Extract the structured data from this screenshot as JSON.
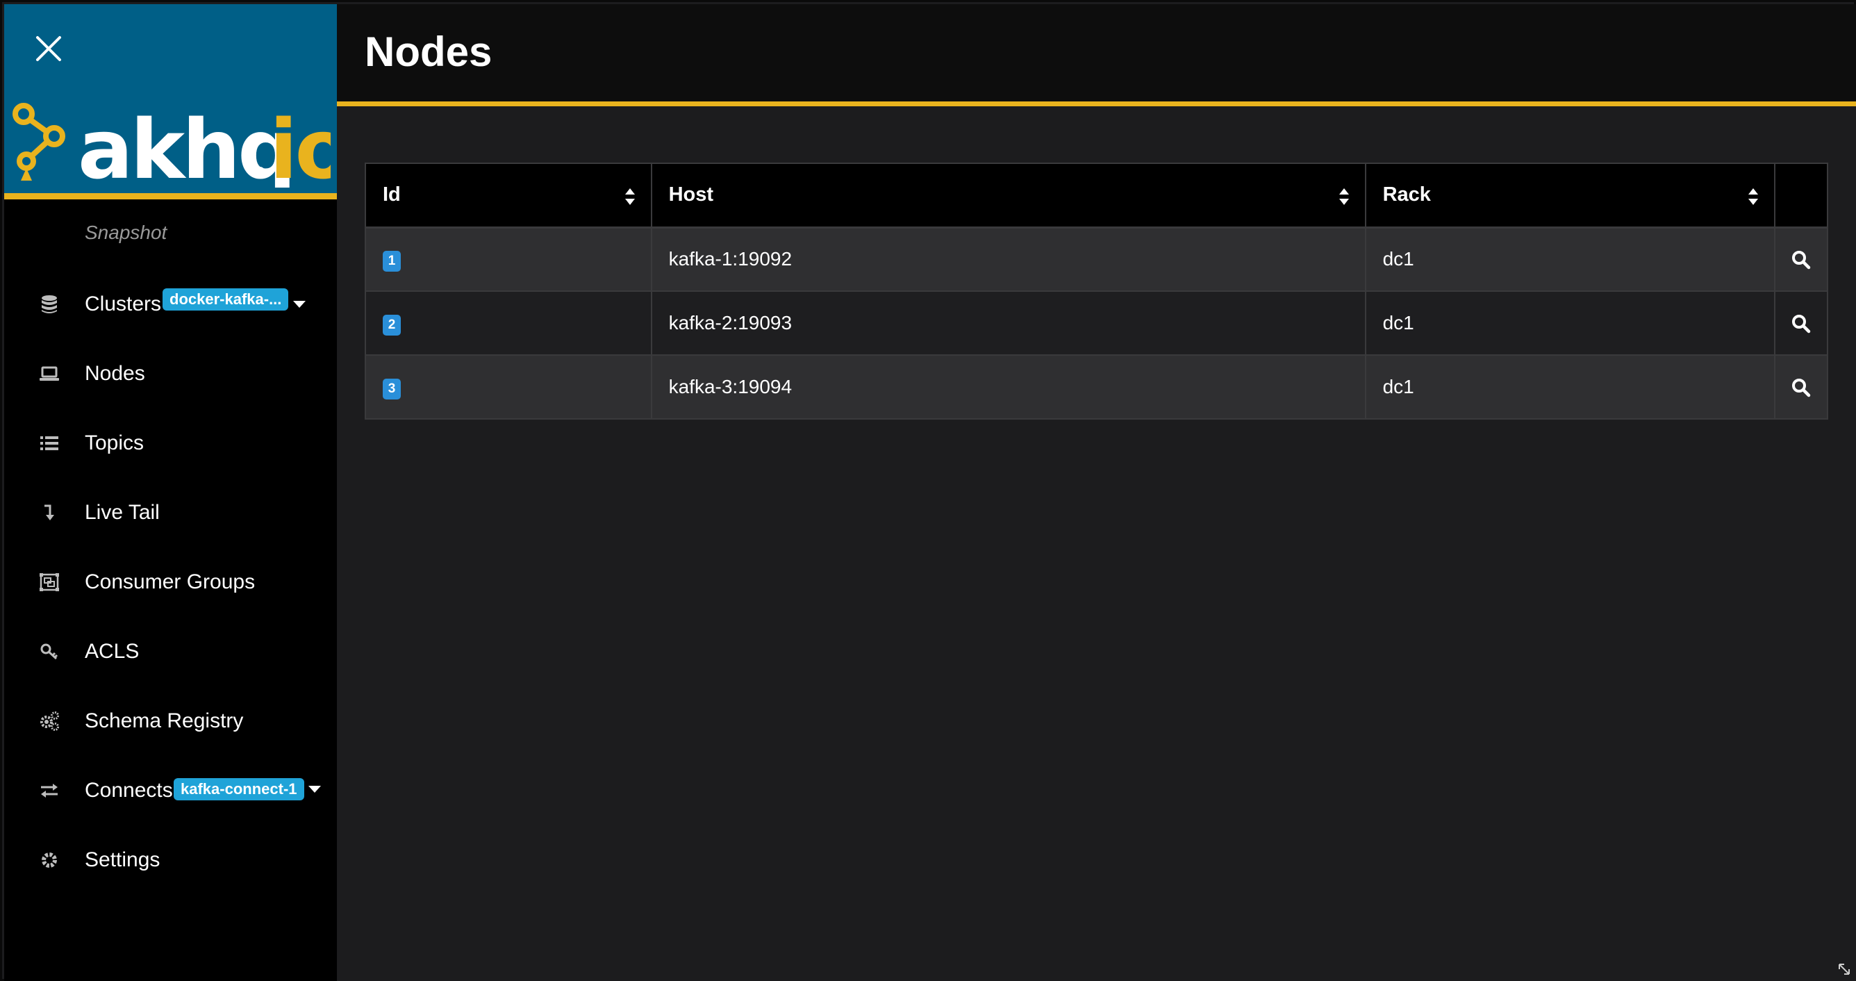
{
  "sidebar": {
    "brand": {
      "logo_text": "akhq.io",
      "logo_colors": {
        "ring": "#e9b31e",
        "text": "#ffffff",
        "accent": "#e9b31e"
      }
    },
    "snapshot_label": "Snapshot",
    "items": [
      {
        "label": "Clusters",
        "icon": "database-icon",
        "badge": "docker-kafka-...",
        "dropdown": true
      },
      {
        "label": "Nodes",
        "icon": "laptop-icon"
      },
      {
        "label": "Topics",
        "icon": "list-icon"
      },
      {
        "label": "Live Tail",
        "icon": "level-down-icon"
      },
      {
        "label": "Consumer Groups",
        "icon": "object-group-icon"
      },
      {
        "label": "ACLS",
        "icon": "key-icon"
      },
      {
        "label": "Schema Registry",
        "icon": "cogs-icon"
      },
      {
        "label": "Connects",
        "icon": "exchange-icon",
        "badge": "kafka-connect-1",
        "dropdown": true
      },
      {
        "label": "Settings",
        "icon": "gear-icon"
      }
    ]
  },
  "header": {
    "title": "Nodes"
  },
  "table": {
    "columns": [
      "Id",
      "Host",
      "Rack",
      ""
    ],
    "rows": [
      {
        "id": "1",
        "host": "kafka-1:19092",
        "rack": "dc1"
      },
      {
        "id": "2",
        "host": "kafka-2:19093",
        "rack": "dc1"
      },
      {
        "id": "3",
        "host": "kafka-3:19094",
        "rack": "dc1"
      }
    ]
  },
  "colors": {
    "accent": "#e9b31e",
    "brand_bg": "#005f87",
    "badge": "#1fa3d8",
    "id_badge": "#2a8fd9"
  }
}
